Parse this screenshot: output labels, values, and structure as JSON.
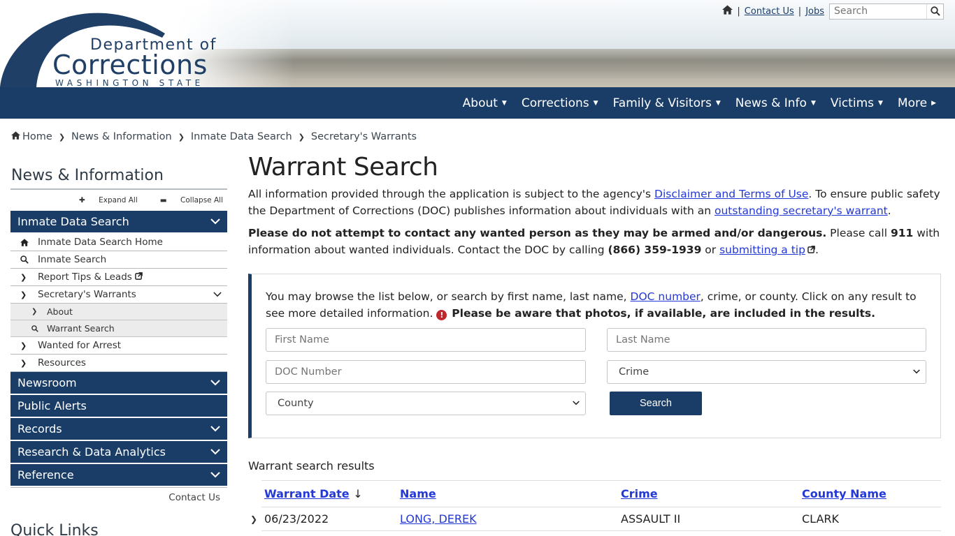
{
  "header": {
    "logo": {
      "line1": "Department of",
      "line2": "Corrections",
      "line3": "WASHINGTON STATE"
    },
    "util": {
      "home_icon": "home-icon",
      "contact": "Contact Us",
      "jobs": "Jobs",
      "search_placeholder": "Search",
      "search_icon": "search-icon"
    }
  },
  "nav": {
    "items": [
      {
        "label": "About",
        "caret": "▼"
      },
      {
        "label": "Corrections",
        "caret": "▼"
      },
      {
        "label": "Family & Visitors",
        "caret": "▼"
      },
      {
        "label": "News & Info",
        "caret": "▼"
      },
      {
        "label": "Victims",
        "caret": "▼"
      },
      {
        "label": "More",
        "caret": "▶"
      }
    ]
  },
  "breadcrumb": [
    "Home",
    "News & Information",
    "Inmate Data Search",
    "Secretary's Warrants"
  ],
  "sidebar": {
    "title": "News & Information",
    "expand_all": "Expand All",
    "collapse_all": "Collapse All",
    "section_inmate": "Inmate Data Search",
    "sub_home": "Inmate Data Search Home",
    "sub_search": "Inmate Search",
    "sub_tips": "Report Tips & Leads",
    "sub_warrants": "Secretary's Warrants",
    "subsub_about": "About",
    "subsub_warrant_search": "Warrant Search",
    "sub_wanted": "Wanted for Arrest",
    "sub_resources": "Resources",
    "section_newsroom": "Newsroom",
    "section_alerts": "Public Alerts",
    "section_records": "Records",
    "section_research": "Research & Data Analytics",
    "section_reference": "Reference",
    "contact": "Contact Us",
    "quick_links": "Quick Links"
  },
  "main": {
    "title": "Warrant Search",
    "p1_a": "All information provided through the application is subject to the agency's ",
    "p1_link1": "Disclaimer and Terms of Use",
    "p1_b": ". To ensure public safety the Department of Corrections (DOC) publishes information about individuals with an ",
    "p1_link2": "outstanding secretary's warrant",
    "p1_c": ".",
    "p2_bold1": "Please do not attempt to contact any wanted person as they may be armed and/or dangerous.",
    "p2_a": " Please call ",
    "p2_bold2": "911",
    "p2_b": " with information about wanted individuals. Contact the DOC by calling ",
    "p2_bold3": "(866) 359-1939",
    "p2_c": " or ",
    "p2_link": "submitting a tip",
    "p2_d": "."
  },
  "form": {
    "intro_a": "You may browse the list below, or search by first name, last name, ",
    "intro_link": "DOC number",
    "intro_b": ", crime, or county. Click on any result to see more detailed information. ",
    "intro_bold": "Please be aware that photos, if available, are included in the results.",
    "first_name_ph": "First Name",
    "last_name_ph": "Last Name",
    "doc_number_ph": "DOC Number",
    "crime_selected": "Crime",
    "county_selected": "County",
    "search_btn": "Search"
  },
  "results": {
    "label": "Warrant search results",
    "headers": {
      "date": "Warrant Date",
      "sort_arrow": "↓",
      "name": "Name",
      "crime": "Crime",
      "county": "County Name"
    },
    "rows": [
      {
        "date": "06/23/2022",
        "name": "LONG, DEREK",
        "crime": "ASSAULT II",
        "county": "CLARK"
      }
    ]
  },
  "colors": {
    "navy": "#1a3d67",
    "link": "#2338d6",
    "alert_red": "#c0272d"
  }
}
